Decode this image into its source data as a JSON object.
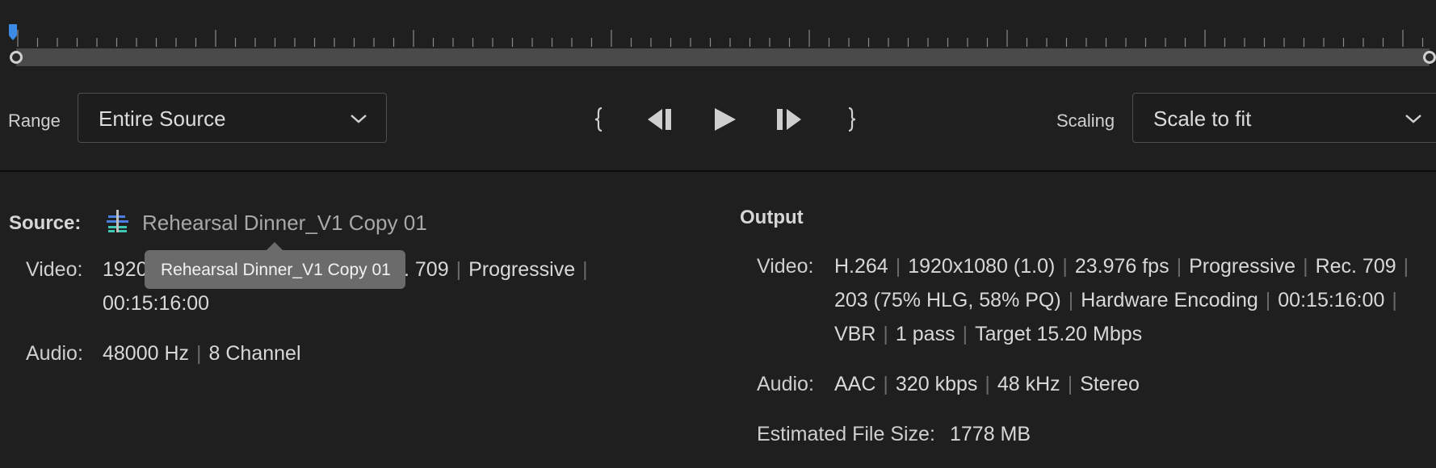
{
  "controls": {
    "range_label": "Range",
    "range_value": "Entire Source",
    "scaling_label": "Scaling",
    "scaling_value": "Scale to fit"
  },
  "source": {
    "label": "Source:",
    "name": "Rehearsal Dinner_V1 Copy 01",
    "tooltip": "Rehearsal Dinner_V1 Copy 01",
    "video_label": "Video:",
    "video_line1": [
      "1920",
      ". 709",
      "Progressive"
    ],
    "video_line2": "00:15:16:00",
    "audio_label": "Audio:",
    "audio": [
      "48000 Hz",
      "8 Channel"
    ]
  },
  "output": {
    "label": "Output",
    "video_label": "Video:",
    "video_line1": [
      "H.264",
      "1920x1080 (1.0)",
      "23.976 fps",
      "Progressive",
      "Rec. 709"
    ],
    "video_line2": [
      "203 (75% HLG, 58% PQ)",
      "Hardware Encoding",
      "00:15:16:00"
    ],
    "video_line3": [
      "VBR",
      "1 pass",
      "Target 15.20 Mbps"
    ],
    "audio_label": "Audio:",
    "audio": [
      "AAC",
      "320 kbps",
      "48 kHz",
      "Stereo"
    ],
    "file_size_label": "Estimated File Size:",
    "file_size_value": "1778 MB"
  },
  "colors": {
    "background": "#1f1f1f",
    "playhead": "#3b8be6",
    "icon_teal": "#3ec8b4",
    "icon_blue": "#4a7fe0"
  },
  "icons": [
    "playhead-marker",
    "chevron-down-icon",
    "mark-in-icon",
    "step-back-icon",
    "play-icon",
    "step-forward-icon",
    "mark-out-icon",
    "sequence-icon"
  ]
}
